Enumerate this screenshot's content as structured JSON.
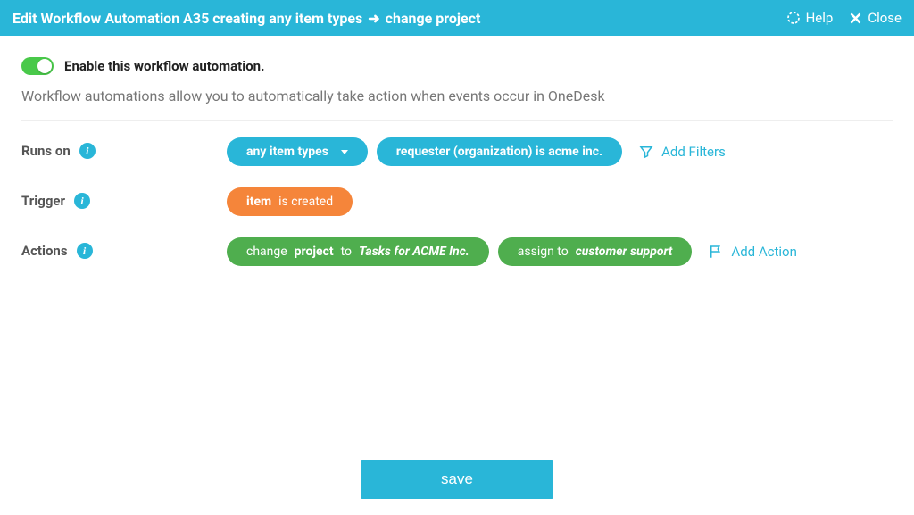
{
  "header": {
    "title_prefix": "Edit Workflow Automation A35 creating any item types",
    "arrow": "➜",
    "title_suffix": "change project",
    "help": "Help",
    "close": "Close"
  },
  "enable": {
    "label": "Enable this workflow automation."
  },
  "description": "Workflow automations allow you to automatically take action when events occur in OneDesk",
  "rows": {
    "runs_on": {
      "label": "Runs on",
      "item_types": "any item types",
      "filter_text": "requester (organization) is acme inc.",
      "add_filters": "Add Filters"
    },
    "trigger": {
      "label": "Trigger",
      "subject": "item",
      "verb": "is created"
    },
    "actions": {
      "label": "Actions",
      "a1_prefix": "change",
      "a1_field": "project",
      "a1_to": "to",
      "a1_value": "Tasks for ACME Inc.",
      "a2_prefix": "assign to",
      "a2_value": "customer support",
      "add_action": "Add Action"
    }
  },
  "save": "save"
}
